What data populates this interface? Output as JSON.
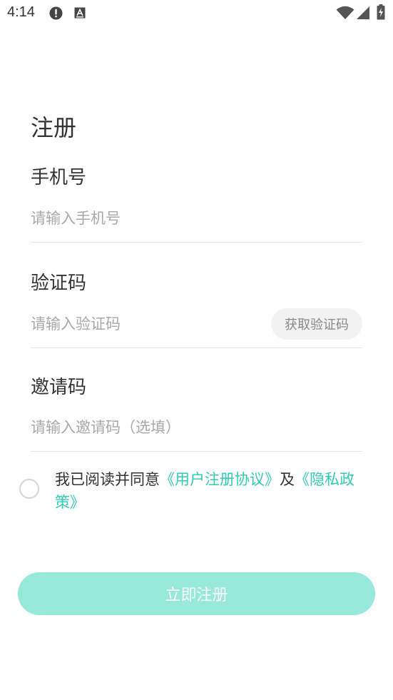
{
  "status_bar": {
    "time": "4:14",
    "icons": [
      "alert-icon",
      "a-notification-icon",
      "wifi-icon",
      "signal-icon",
      "battery-charging-icon"
    ]
  },
  "page": {
    "title": "注册"
  },
  "phone": {
    "label": "手机号",
    "placeholder": "请输入手机号",
    "value": ""
  },
  "code": {
    "label": "验证码",
    "placeholder": "请输入验证码",
    "value": "",
    "get_code_label": "获取验证码"
  },
  "invite": {
    "label": "邀请码",
    "placeholder": "请输入邀请码（选填）",
    "value": ""
  },
  "agreement": {
    "checked": false,
    "prefix": "我已阅读并同意",
    "user_agreement": "《用户注册协议》",
    "conjunction": "及",
    "privacy_policy": "《隐私政策》"
  },
  "submit": {
    "label": "立即注册"
  },
  "colors": {
    "accent": "#2fcfb3",
    "button_disabled": "#97e9da",
    "divider": "#e6e6e6"
  }
}
